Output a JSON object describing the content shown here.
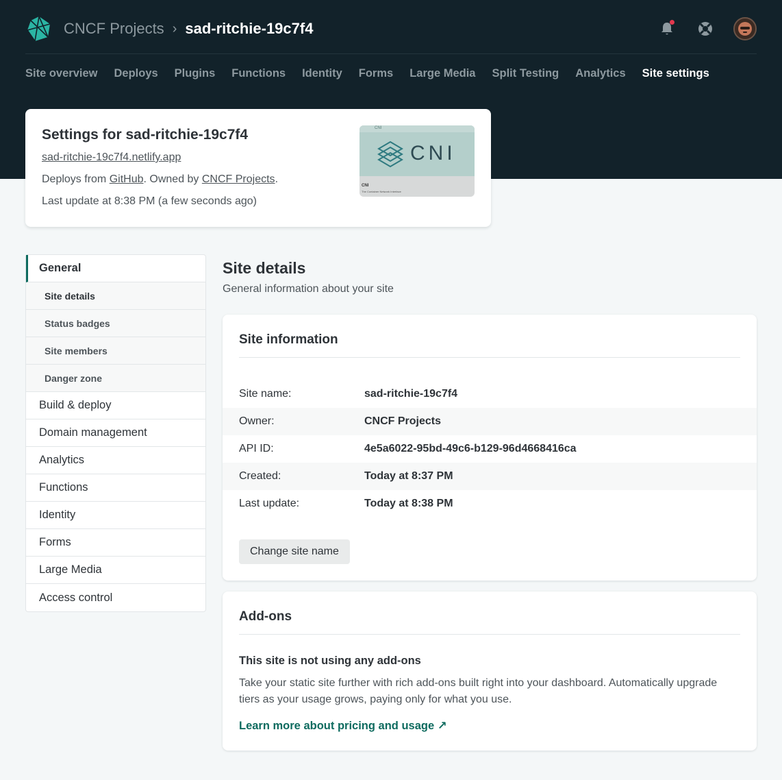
{
  "header": {
    "team": "CNCF Projects",
    "separator": "›",
    "site": "sad-ritchie-19c7f4",
    "icons": [
      "bell-icon",
      "support-icon",
      "avatar"
    ]
  },
  "nav": {
    "tabs": [
      {
        "label": "Site overview"
      },
      {
        "label": "Deploys"
      },
      {
        "label": "Plugins"
      },
      {
        "label": "Functions"
      },
      {
        "label": "Identity"
      },
      {
        "label": "Forms"
      },
      {
        "label": "Large Media"
      },
      {
        "label": "Split Testing"
      },
      {
        "label": "Analytics"
      },
      {
        "label": "Site settings",
        "active": true
      }
    ]
  },
  "site_card": {
    "title": "Settings for sad-ritchie-19c7f4",
    "url": "sad-ritchie-19c7f4.netlify.app",
    "deploys_prefix": "Deploys from ",
    "deploys_source": "GitHub",
    "owned_prefix": ". Owned by ",
    "owner": "CNCF Projects",
    "owned_suffix": ".",
    "last_update": "Last update at 8:38 PM (a few seconds ago)",
    "thumbnail": {
      "bar_text": "CNI",
      "logo_text": "CNI",
      "caption": "CNI",
      "caption_sub": "The Container Network Interface"
    }
  },
  "sidenav": {
    "items": [
      {
        "label": "General",
        "active": true
      },
      {
        "label": "Site details",
        "sub": true,
        "current": true
      },
      {
        "label": "Status badges",
        "sub": true
      },
      {
        "label": "Site members",
        "sub": true
      },
      {
        "label": "Danger zone",
        "sub": true
      },
      {
        "label": "Build & deploy"
      },
      {
        "label": "Domain management"
      },
      {
        "label": "Analytics"
      },
      {
        "label": "Functions"
      },
      {
        "label": "Identity"
      },
      {
        "label": "Forms"
      },
      {
        "label": "Large Media"
      },
      {
        "label": "Access control"
      }
    ]
  },
  "main": {
    "title": "Site details",
    "subtitle": "General information about your site",
    "info_card": {
      "heading": "Site information",
      "rows": [
        {
          "label": "Site name:",
          "value": "sad-ritchie-19c7f4"
        },
        {
          "label": "Owner:",
          "value": "CNCF Projects"
        },
        {
          "label": "API ID:",
          "value": "4e5a6022-95bd-49c6-b129-96d4668416ca"
        },
        {
          "label": "Created:",
          "value": "Today at 8:37 PM"
        },
        {
          "label": "Last update:",
          "value": "Today at 8:38 PM"
        }
      ],
      "button": "Change site name"
    },
    "addons_card": {
      "heading": "Add-ons",
      "subheading": "This site is not using any add-ons",
      "text": "Take your static site further with rich add-ons built right into your dashboard. Automatically upgrade tiers as your usage grows, paying only for what you use.",
      "link": "Learn more about pricing and usage ↗"
    }
  },
  "colors": {
    "header_bg": "#12222a",
    "accent": "#0e6b5f",
    "notification": "#e3384e"
  }
}
